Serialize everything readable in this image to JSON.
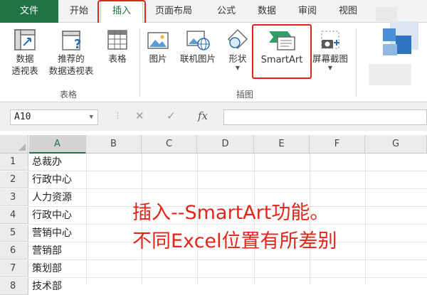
{
  "tabs": {
    "file": "文件",
    "items": [
      "开始",
      "插入",
      "页面布局",
      "公式",
      "数据",
      "审阅",
      "视图"
    ]
  },
  "ribbon": {
    "pivot_table": [
      "数据",
      "透视表"
    ],
    "recommended_pivot": [
      "推荐的",
      "数据透视表"
    ],
    "table": "表格",
    "group_tables": "表格",
    "picture": "图片",
    "online_picture": "联机图片",
    "shapes": "形状",
    "smartart": "SmartArt",
    "screenshot": "屏幕截图",
    "group_illustrations": "插图"
  },
  "formula_bar": {
    "name_box": "A10",
    "cancel_icon": "✕",
    "enter_icon": "✓",
    "fx": "fx"
  },
  "columns": [
    "A",
    "B",
    "C",
    "D",
    "E",
    "F",
    "G"
  ],
  "rows": [
    {
      "num": "1",
      "a": "总裁办"
    },
    {
      "num": "2",
      "a": "行政中心"
    },
    {
      "num": "3",
      "a": "人力资源"
    },
    {
      "num": "4",
      "a": "行政中心"
    },
    {
      "num": "5",
      "a": "营销中心"
    },
    {
      "num": "6",
      "a": "营销部"
    },
    {
      "num": "7",
      "a": "策划部"
    },
    {
      "num": "8",
      "a": "技术部"
    }
  ],
  "annotation": {
    "line1": "插入--SmartArt功能。",
    "line2": "不同Excel位置有所差别"
  },
  "colors": {
    "excel_green": "#217346",
    "highlight_red": "#e0251c",
    "note_red": "#e3261a"
  }
}
